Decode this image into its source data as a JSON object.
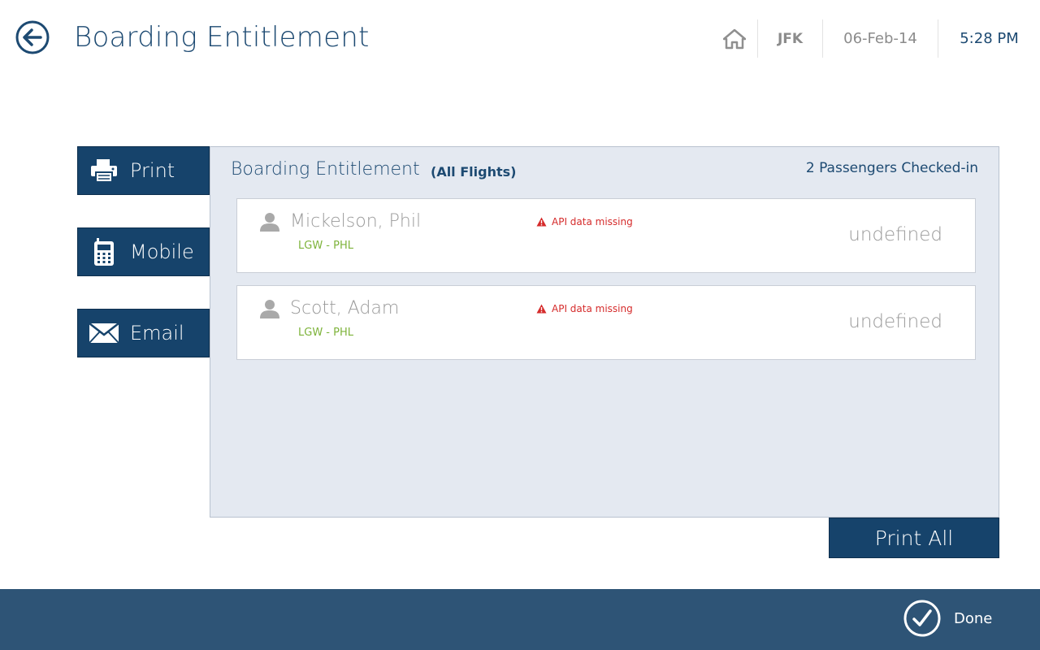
{
  "header": {
    "back_icon": "back-arrow-circle-icon",
    "title": "Boarding Entitlement",
    "home_icon": "home-icon",
    "station": "JFK",
    "date": "06-Feb-14",
    "time": "5:28 PM"
  },
  "side_actions": [
    {
      "label": "Print",
      "icon": "printer-icon"
    },
    {
      "label": "Mobile",
      "icon": "mobile-phone-icon"
    },
    {
      "label": "Email",
      "icon": "envelope-icon"
    }
  ],
  "panel": {
    "title": "Boarding Entitlement",
    "subtitle": "(All Flights)",
    "count_text": "2 Passengers Checked-in",
    "passengers": [
      {
        "name": "Mickelson, Phil",
        "route": "LGW - PHL",
        "warning": "API data missing",
        "status": "undefined"
      },
      {
        "name": "Scott, Adam",
        "route": "LGW - PHL",
        "warning": "API data missing",
        "status": "undefined"
      }
    ]
  },
  "print_all_label": "Print All",
  "footer": {
    "done_label": "Done",
    "done_icon": "check-circle-icon"
  },
  "colors": {
    "primary": "#16436b",
    "footer": "#2e5476",
    "panel_bg": "#e4e9f1",
    "title_text": "#1d4a72",
    "route_green": "#7db33a",
    "warning_red": "#d52b2b",
    "muted_text": "#9a9a9a"
  }
}
